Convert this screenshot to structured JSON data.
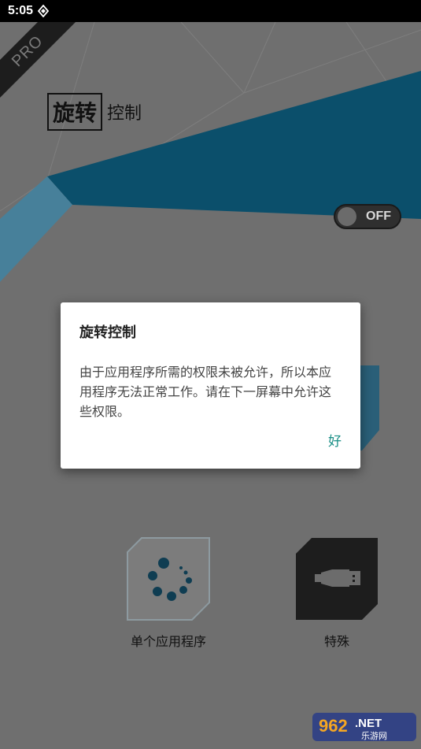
{
  "status_bar": {
    "time": "5:05"
  },
  "app": {
    "pro_badge": "PRO",
    "title_boxed": "旋转",
    "title_rest": "控制",
    "toggle_label": "OFF",
    "cells": [
      {
        "label": "单个应用程序"
      },
      {
        "label": "特殊"
      }
    ]
  },
  "dialog": {
    "title": "旋转控制",
    "message": "由于应用程序所需的权限未被允许，所以本应用程序无法正常工作。请在下一屏幕中允许这些权限。",
    "ok": "好"
  },
  "watermark": {
    "number": "962",
    "suffix": ".NET",
    "cn": "乐游网"
  },
  "colors": {
    "accent": "#0b4f6b",
    "dialog_button": "#1a8f86"
  }
}
